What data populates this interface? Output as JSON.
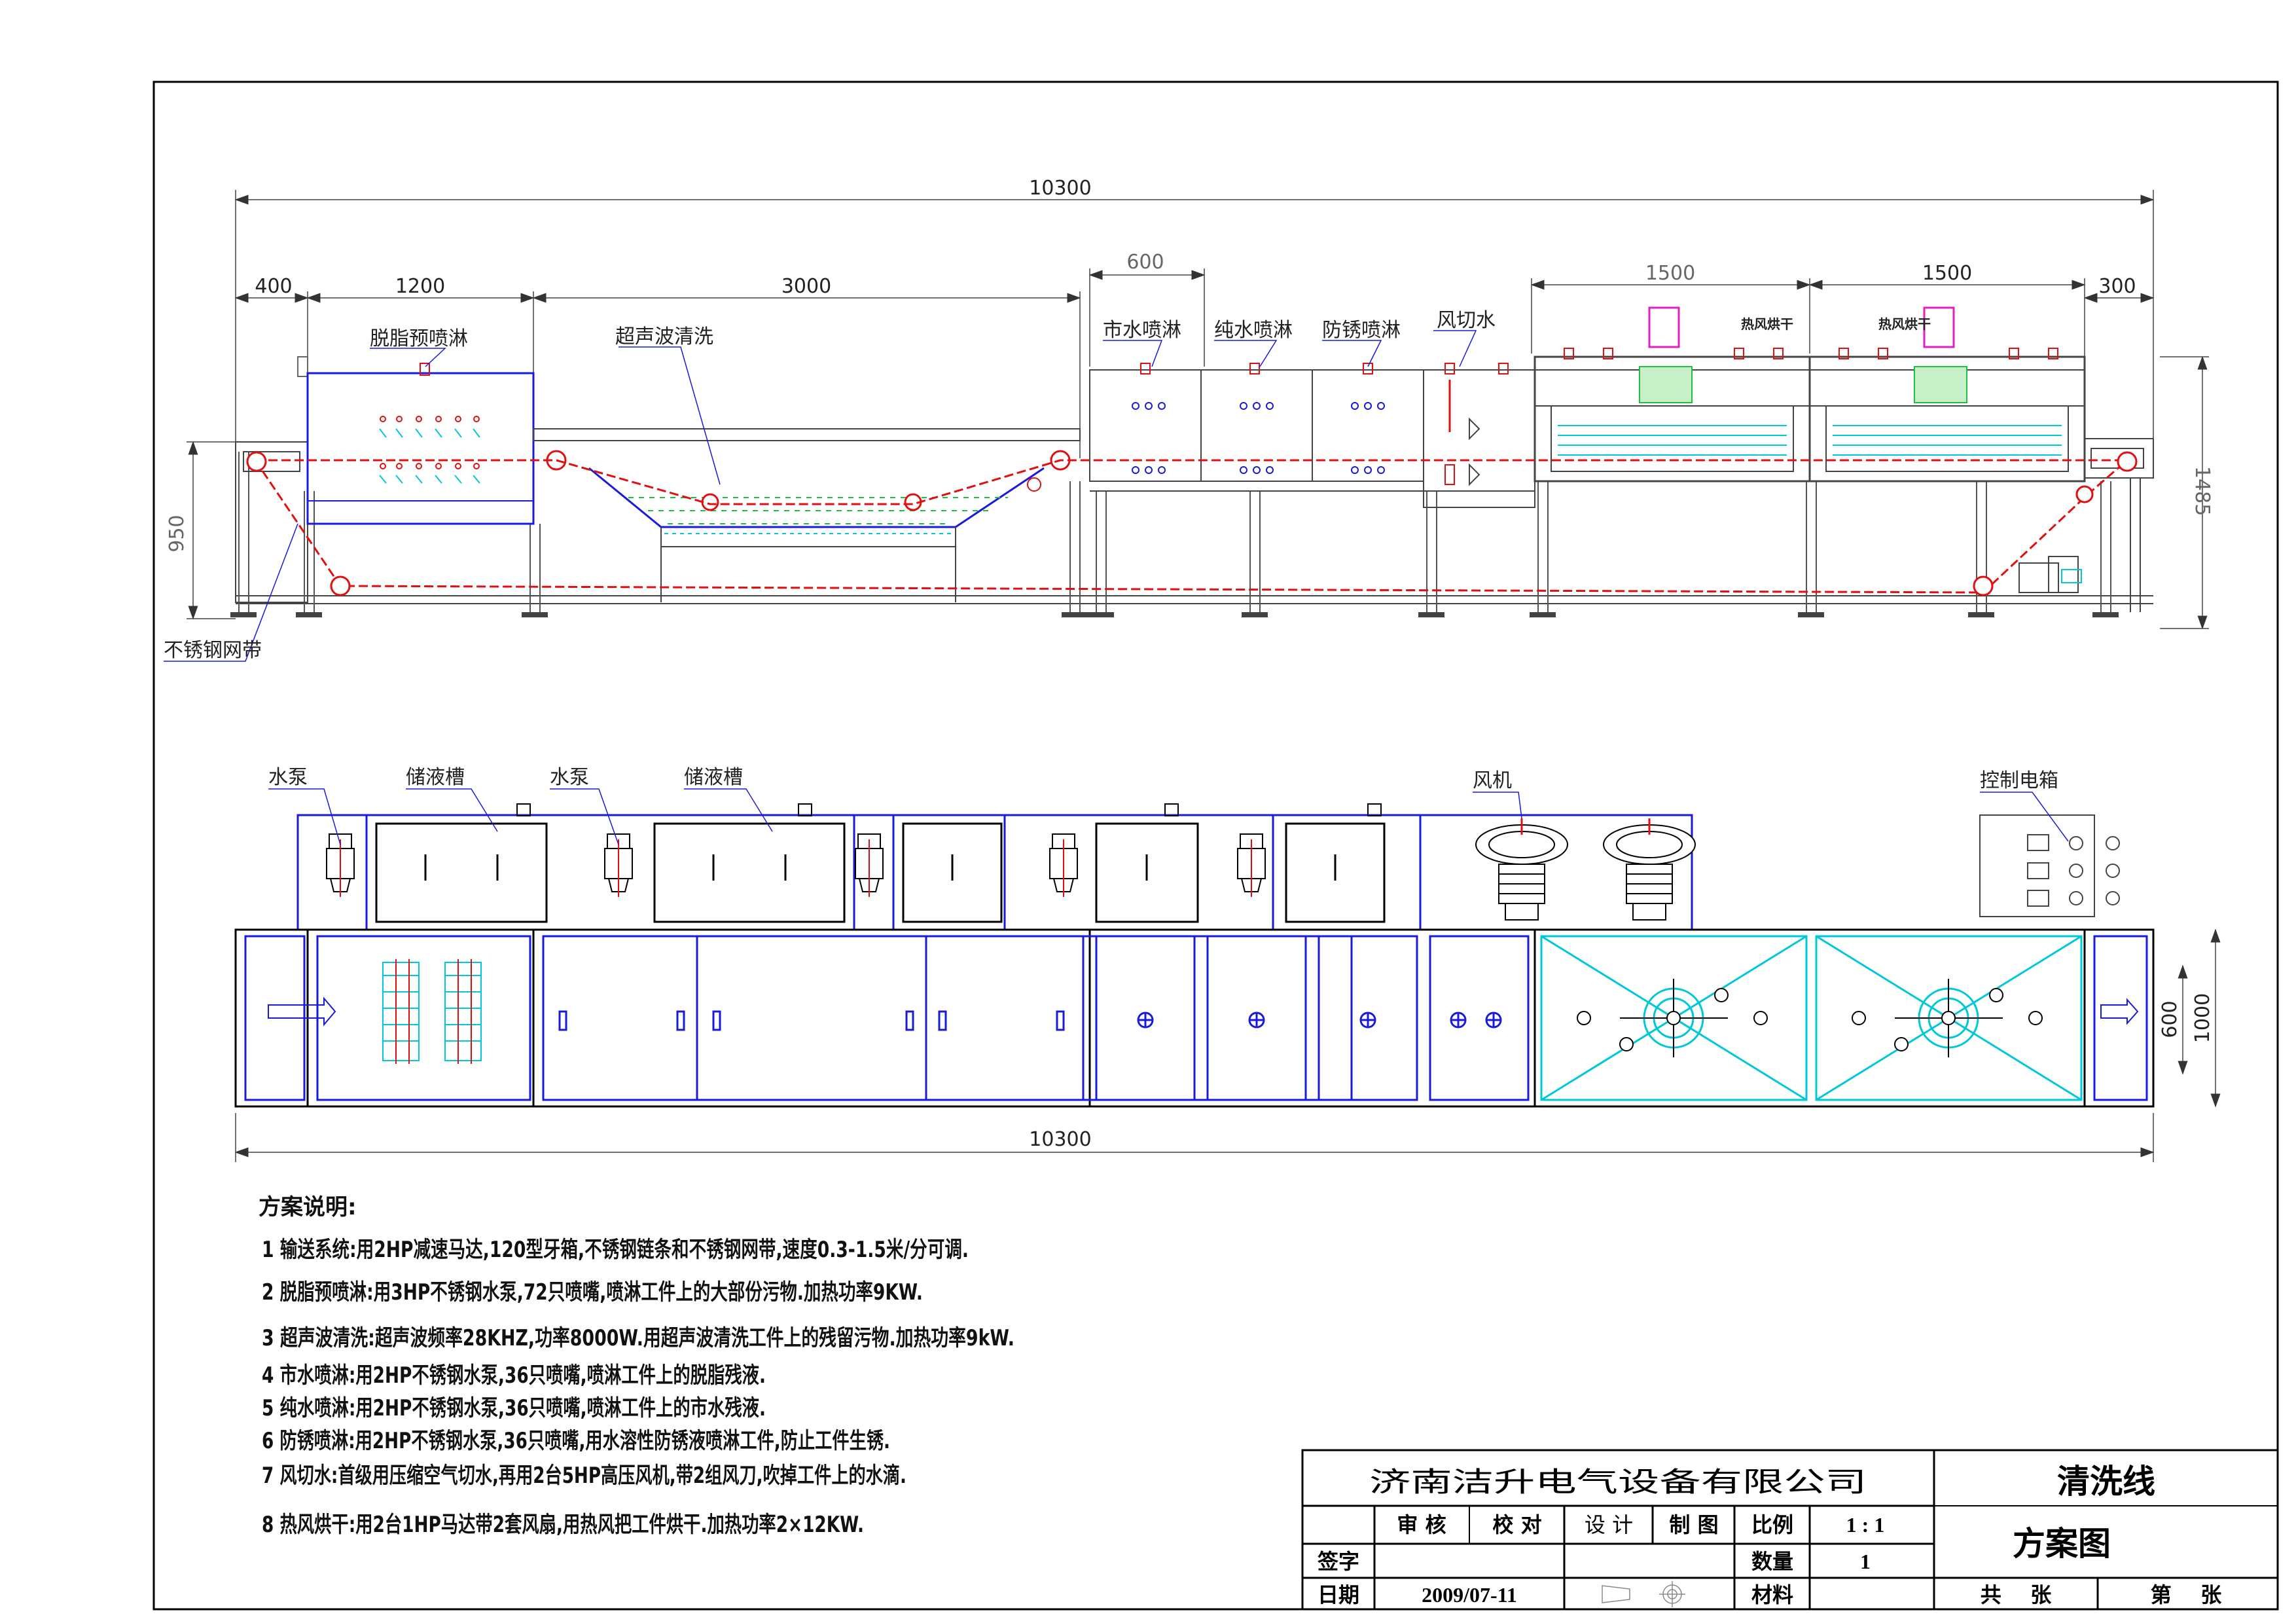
{
  "dimensions": {
    "overall_length": "10300",
    "section_400": "400",
    "section_1200": "1200",
    "section_3000": "3000",
    "section_600": "600",
    "section_1500_a": "1500",
    "section_1500_b": "1500",
    "section_300": "300",
    "height_950": "950",
    "height_1485": "1485",
    "plan_length": "10300",
    "plan_width_600": "600",
    "plan_width_1000": "1000"
  },
  "elevation_labels": {
    "degrease_spray": "脱脂预喷淋",
    "ultrasonic_clean": "超声波清洗",
    "city_water_spray": "市水喷淋",
    "pure_water_spray": "纯水喷淋",
    "antirust_spray": "防锈喷淋",
    "air_knife": "风切水",
    "hot_air_dry_a": "热风烘干",
    "hot_air_dry_b": "热风烘干",
    "mesh_belt": "不锈钢网带"
  },
  "plan_labels": {
    "pump_a": "水泵",
    "tank_a": "储液槽",
    "pump_b": "水泵",
    "tank_b": "储液槽",
    "blower": "风机",
    "control_box": "控制电箱"
  },
  "notes": {
    "heading": "方案说明:",
    "lines": [
      "1 输送系统:用2HP减速马达,120型牙箱,不锈钢链条和不锈钢网带,速度0.3-1.5米/分可调.",
      "2 脱脂预喷淋:用3HP不锈钢水泵,72只喷嘴,喷淋工件上的大部份污物.加热功率9KW.",
      "3 超声波清洗:超声波频率28KHZ,功率8000W.用超声波清洗工件上的残留污物.加热功率9kW.",
      "4 市水喷淋:用2HP不锈钢水泵,36只喷嘴,喷淋工件上的脱脂残液.",
      "5 纯水喷淋:用2HP不锈钢水泵,36只喷嘴,喷淋工件上的市水残液.",
      "6 防锈喷淋:用2HP不锈钢水泵,36只喷嘴,用水溶性防锈液喷淋工件,防止工件生锈.",
      "7 风切水:首级用压缩空气切水,再用2台5HP高压风机,带2组风刀,吹掉工件上的水滴.",
      "8 热风烘干:用2台1HP马达带2套风扇,用热风把工件烘干.加热功率2×12KW."
    ]
  },
  "title_block": {
    "company": "济南洁升电气设备有限公司",
    "title": "清洗线",
    "subtitle": "方案图",
    "review": "审 核",
    "check": "校 对",
    "design": "设 计",
    "draft": "制 图",
    "scale_label": "比例",
    "scale_value": "1 : 1",
    "qty_label": "数量",
    "qty_value": "1",
    "sign_label": "签字",
    "date_label": "日期",
    "date_value": "2009/07-11",
    "material_label": "材料",
    "total_sheets": "共    张",
    "sheet_no": "第    张"
  },
  "colors": {
    "line": "#000000",
    "blue": "#1a1adc",
    "red": "#e01010",
    "cyan": "#00c8d8",
    "green": "#20c040",
    "magenta": "#e020c0",
    "dimension": "#555555"
  }
}
